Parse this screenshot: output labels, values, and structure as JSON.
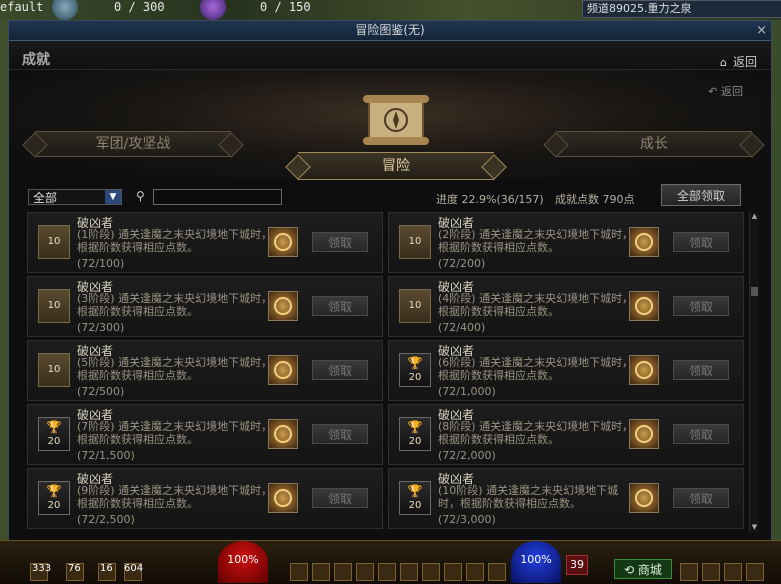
{
  "hud": {
    "top_left_text": "efault",
    "hp_readout": "0 / 300",
    "mp_readout": "0 / 150",
    "channel": "频道89025.重力之泉",
    "hp_orb": "100%",
    "mp_orb": "100%",
    "level": "39",
    "shop_label": "商城",
    "item_counts": [
      "333",
      "76",
      "16",
      "604"
    ]
  },
  "window": {
    "title": "冒险图鉴(无)",
    "close_label": "×"
  },
  "achievement": {
    "header": "成就",
    "home_label": "返回",
    "back_label": "返回",
    "tabs": {
      "legion": "军团/攻坚战",
      "adventure": "冒险",
      "growth": "成长"
    },
    "filter_value": "全部",
    "search_placeholder": "",
    "progress": "进度  22.9%(36/157)",
    "points": "成就点数 790点",
    "claim_all": "全部领取",
    "claim_label": "领取",
    "items": [
      {
        "title": "破凶者",
        "desc": "(1阶段) 通关逢魔之末央幻境地下城时，根据阶数获得相应点数。",
        "progress": "(72/100)",
        "badge": "10",
        "trophy": false
      },
      {
        "title": "破凶者",
        "desc": "(2阶段) 通关逢魔之末央幻境地下城时，根据阶数获得相应点数。",
        "progress": "(72/200)",
        "badge": "10",
        "trophy": false
      },
      {
        "title": "破凶者",
        "desc": "(3阶段) 通关逢魔之末央幻境地下城时，根据阶数获得相应点数。",
        "progress": "(72/300)",
        "badge": "10",
        "trophy": false
      },
      {
        "title": "破凶者",
        "desc": "(4阶段) 通关逢魔之末央幻境地下城时，根据阶数获得相应点数。",
        "progress": "(72/400)",
        "badge": "10",
        "trophy": false
      },
      {
        "title": "破凶者",
        "desc": "(5阶段) 通关逢魔之末央幻境地下城时，根据阶数获得相应点数。",
        "progress": "(72/500)",
        "badge": "10",
        "trophy": false
      },
      {
        "title": "破凶者",
        "desc": "(6阶段) 通关逢魔之末央幻境地下城时，根据阶数获得相应点数。",
        "progress": "(72/1,000)",
        "badge": "20",
        "trophy": true
      },
      {
        "title": "破凶者",
        "desc": "(7阶段) 通关逢魔之末央幻境地下城时，根据阶数获得相应点数。",
        "progress": "(72/1,500)",
        "badge": "20",
        "trophy": true
      },
      {
        "title": "破凶者",
        "desc": "(8阶段) 通关逢魔之末央幻境地下城时，根据阶数获得相应点数。",
        "progress": "(72/2,000)",
        "badge": "20",
        "trophy": true
      },
      {
        "title": "破凶者",
        "desc": "(9阶段) 通关逢魔之末央幻境地下城时，根据阶数获得相应点数。",
        "progress": "(72/2,500)",
        "badge": "20",
        "trophy": true
      },
      {
        "title": "破凶者",
        "desc": "(10阶段) 通关逢魔之末央幻境地下城时，根据阶数获得相应点数。",
        "progress": "(72/3,000)",
        "badge": "20",
        "trophy": true
      }
    ]
  }
}
